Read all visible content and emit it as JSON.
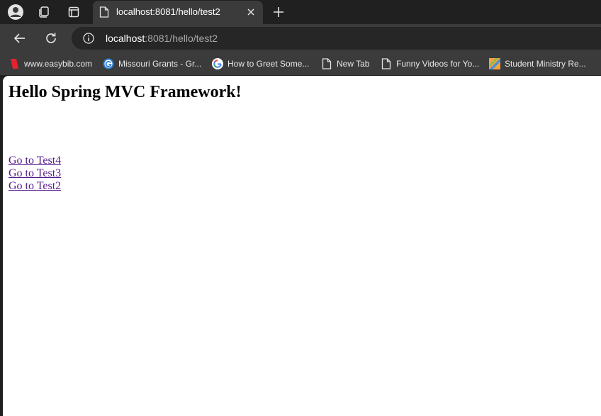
{
  "tab": {
    "title": "localhost:8081/hello/test2"
  },
  "address_bar": {
    "host": "localhost",
    "rest": ":8081/hello/test2"
  },
  "bookmarks": [
    {
      "label": "www.easybib.com",
      "icon": "easybib-icon"
    },
    {
      "label": "Missouri Grants - Gr...",
      "icon": "grants-icon"
    },
    {
      "label": "How to Greet Some...",
      "icon": "google-icon"
    },
    {
      "label": "New Tab",
      "icon": "page-icon"
    },
    {
      "label": "Funny Videos for Yo...",
      "icon": "page-icon"
    },
    {
      "label": "Student Ministry Re...",
      "icon": "ministry-icon"
    }
  ],
  "page": {
    "heading": "Hello Spring MVC Framework!",
    "links": [
      {
        "label": "Go to Test4"
      },
      {
        "label": "Go to Test3"
      },
      {
        "label": "Go to Test2"
      }
    ]
  },
  "colors": {
    "link": "#551a8b",
    "chrome_bg": "#202020",
    "toolbar_bg": "#3b3b3b"
  }
}
